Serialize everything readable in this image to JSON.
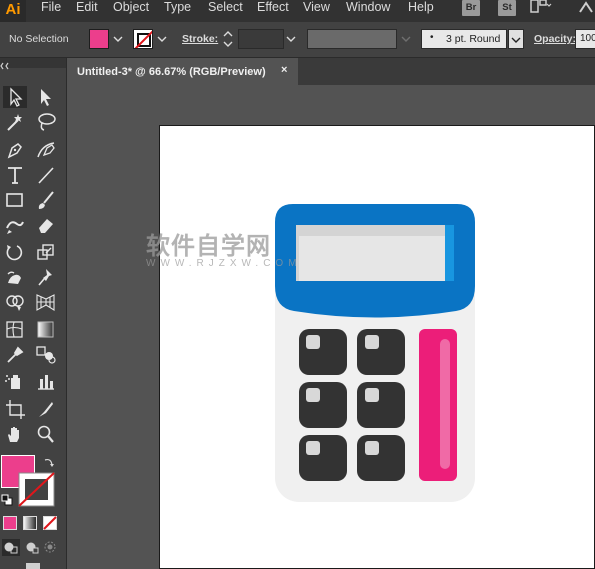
{
  "app": {
    "logo": "Ai"
  },
  "menu": [
    "File",
    "Edit",
    "Object",
    "Type",
    "Select",
    "Effect",
    "View",
    "Window",
    "Help"
  ],
  "bridge_badges": [
    "Br",
    "St"
  ],
  "control_bar": {
    "selection_label": "No Selection",
    "stroke_label": "Stroke:",
    "brush_value": "3 pt. Round",
    "opacity_label": "Opacity:",
    "opacity_value": "100",
    "fill_color": "#ec3e8c",
    "stroke_color": "none"
  },
  "document_tab": {
    "title": "Untitled-3* @ 66.67% (RGB/Preview)",
    "close": "×"
  },
  "toolbar": {
    "fill_color": "#ec3e8c",
    "tools": [
      "selection",
      "direct-selection",
      "magic-wand",
      "lasso",
      "pen",
      "curvature",
      "type",
      "line-segment",
      "rectangle",
      "paintbrush",
      "shaper",
      "eraser",
      "rotate",
      "scale",
      "warp",
      "puppet-warp",
      "shape-builder",
      "perspective-grid",
      "mesh",
      "gradient",
      "eyedropper",
      "blend",
      "symbol-sprayer",
      "column-graph",
      "artboard",
      "slice",
      "hand",
      "zoom"
    ]
  },
  "artwork": {
    "body_color": "#f0f0f0",
    "header_color": "#0a74c4",
    "screen_color": "#e6e6e6",
    "key_color": "#333333",
    "accent_key_color": "#ec1e79"
  },
  "watermark": {
    "title": "软件自学网",
    "sub": "WWW.RJZXW.COM"
  }
}
